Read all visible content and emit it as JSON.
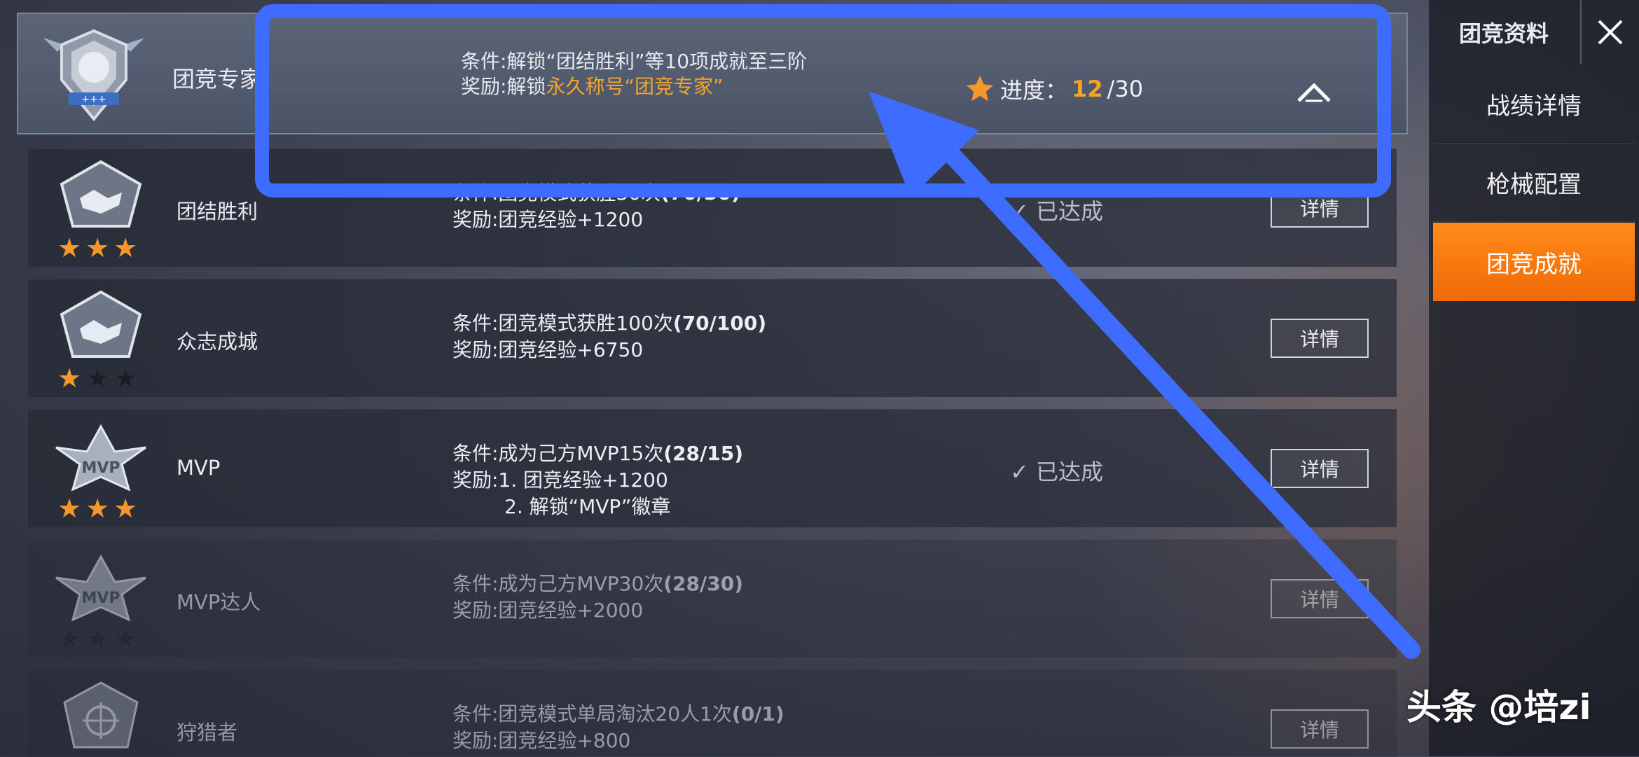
{
  "header": {
    "name": "团竞专家",
    "condition": "条件:解锁“团结胜利”等10项成就至三阶",
    "reward_prefix": "奖励:解锁",
    "reward_highlight": "永久称号“团竞专家”",
    "progress_label": "进度：",
    "progress_current": "12",
    "progress_total": "/30"
  },
  "rows": [
    {
      "name": "团结胜利",
      "condition_text": "条件:团竞模式获胜30次",
      "condition_count": "(70/30)",
      "reward": "奖励:团竞经验+1200",
      "reward2": "",
      "status": "已达成",
      "button": "详情",
      "stars_on": 3,
      "dim": false
    },
    {
      "name": "众志成城",
      "condition_text": "条件:团竞模式获胜100次",
      "condition_count": "(70/100)",
      "reward": "奖励:团竞经验+6750",
      "reward2": "",
      "status": "",
      "button": "详情",
      "stars_on": 1,
      "dim": false
    },
    {
      "name": "MVP",
      "condition_text": "条件:成为己方MVP15次",
      "condition_count": "(28/15)",
      "reward": "奖励:1. 团竞经验+1200",
      "reward2": "2. 解锁“MVP”徽章",
      "status": "已达成",
      "button": "详情",
      "stars_on": 3,
      "dim": false
    },
    {
      "name": "MVP达人",
      "condition_text": "条件:成为己方MVP30次",
      "condition_count": "(28/30)",
      "reward": "奖励:团竞经验+2000",
      "reward2": "",
      "status": "",
      "button": "详情",
      "stars_on": 0,
      "dim": true
    },
    {
      "name": "狩猎者",
      "condition_text": "条件:团竞模式单局淘汰20人1次",
      "condition_count": "(0/1)",
      "reward": "奖励:团竞经验+800",
      "reward2": "",
      "status": "",
      "button": "详情",
      "stars_on": 0,
      "dim": true
    }
  ],
  "sidebar": {
    "title": "团竞资料",
    "items": [
      "战绩详情",
      "枪械配置",
      "团竞成就"
    ],
    "active_index": 2
  },
  "watermark": "头条 @培zi",
  "colors": {
    "accent": "#f5972a",
    "annotation": "#3d6cff",
    "active_tab": "#f57a10"
  }
}
